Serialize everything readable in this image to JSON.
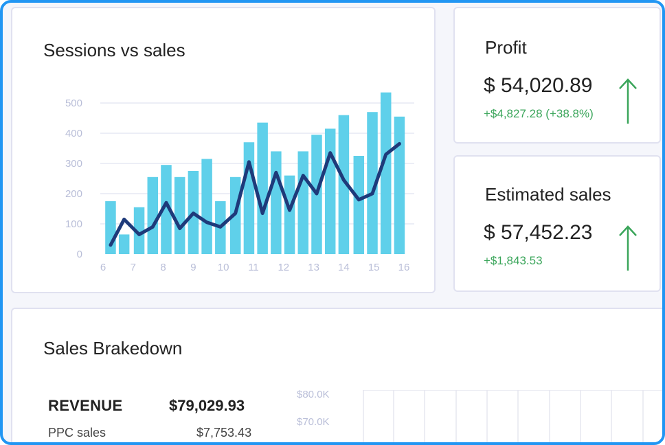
{
  "sessions_card": {
    "title": "Sessions vs sales"
  },
  "profit_card": {
    "title": "Profit",
    "value": "$ 54,020.89",
    "delta": "+$4,827.28 (+38.8%)",
    "trend_icon": "arrow-up-icon",
    "delta_color": "#3aa55a"
  },
  "estimated_card": {
    "title": "Estimated sales",
    "value": "$ 57,452.23",
    "delta": "+$1,843.53",
    "trend_icon": "arrow-up-icon",
    "delta_color": "#3aa55a"
  },
  "breakdown_card": {
    "title": "Sales Brakedown",
    "revenue_label": "REVENUE",
    "revenue_value": "$79,029.93",
    "rows": [
      {
        "label": "PPC sales",
        "value": "$7,753.43"
      }
    ],
    "axis_ticks": [
      "$80.0K",
      "$70.0K"
    ]
  },
  "colors": {
    "bar": "#5fd0ea",
    "line": "#1e3a7a",
    "accent_border": "#2196f3",
    "positive": "#3aa55a"
  },
  "chart_data": {
    "type": "bar",
    "title": "Sessions vs sales",
    "xlabel": "",
    "ylabel": "",
    "ylim": [
      0,
      500
    ],
    "yticks": [
      0,
      100,
      200,
      300,
      400,
      500
    ],
    "xticks": [
      6,
      7,
      8,
      9,
      10,
      11,
      12,
      13,
      14,
      15,
      16
    ],
    "xlim": [
      6,
      16
    ],
    "grid": true,
    "legend": "none",
    "series": [
      {
        "type": "bar",
        "x": [
          6.25,
          6.7,
          7.2,
          7.65,
          8.1,
          8.55,
          9.0,
          9.45,
          9.9,
          10.4,
          10.85,
          11.3,
          11.75,
          12.2,
          12.65,
          13.1,
          13.55,
          14.0,
          14.5,
          14.95,
          15.4,
          15.85
        ],
        "values": [
          175,
          65,
          155,
          255,
          295,
          255,
          275,
          315,
          175,
          255,
          370,
          435,
          340,
          260,
          340,
          395,
          415,
          460,
          325,
          470,
          535,
          455
        ]
      },
      {
        "type": "line",
        "x": [
          6.25,
          6.7,
          7.2,
          7.65,
          8.1,
          8.55,
          9.0,
          9.45,
          9.9,
          10.4,
          10.85,
          11.3,
          11.75,
          12.2,
          12.65,
          13.1,
          13.55,
          14.0,
          14.5,
          14.95,
          15.4,
          15.85
        ],
        "values": [
          30,
          115,
          65,
          90,
          170,
          85,
          135,
          105,
          90,
          135,
          305,
          135,
          270,
          145,
          260,
          200,
          335,
          245,
          180,
          200,
          330,
          365
        ]
      }
    ]
  }
}
